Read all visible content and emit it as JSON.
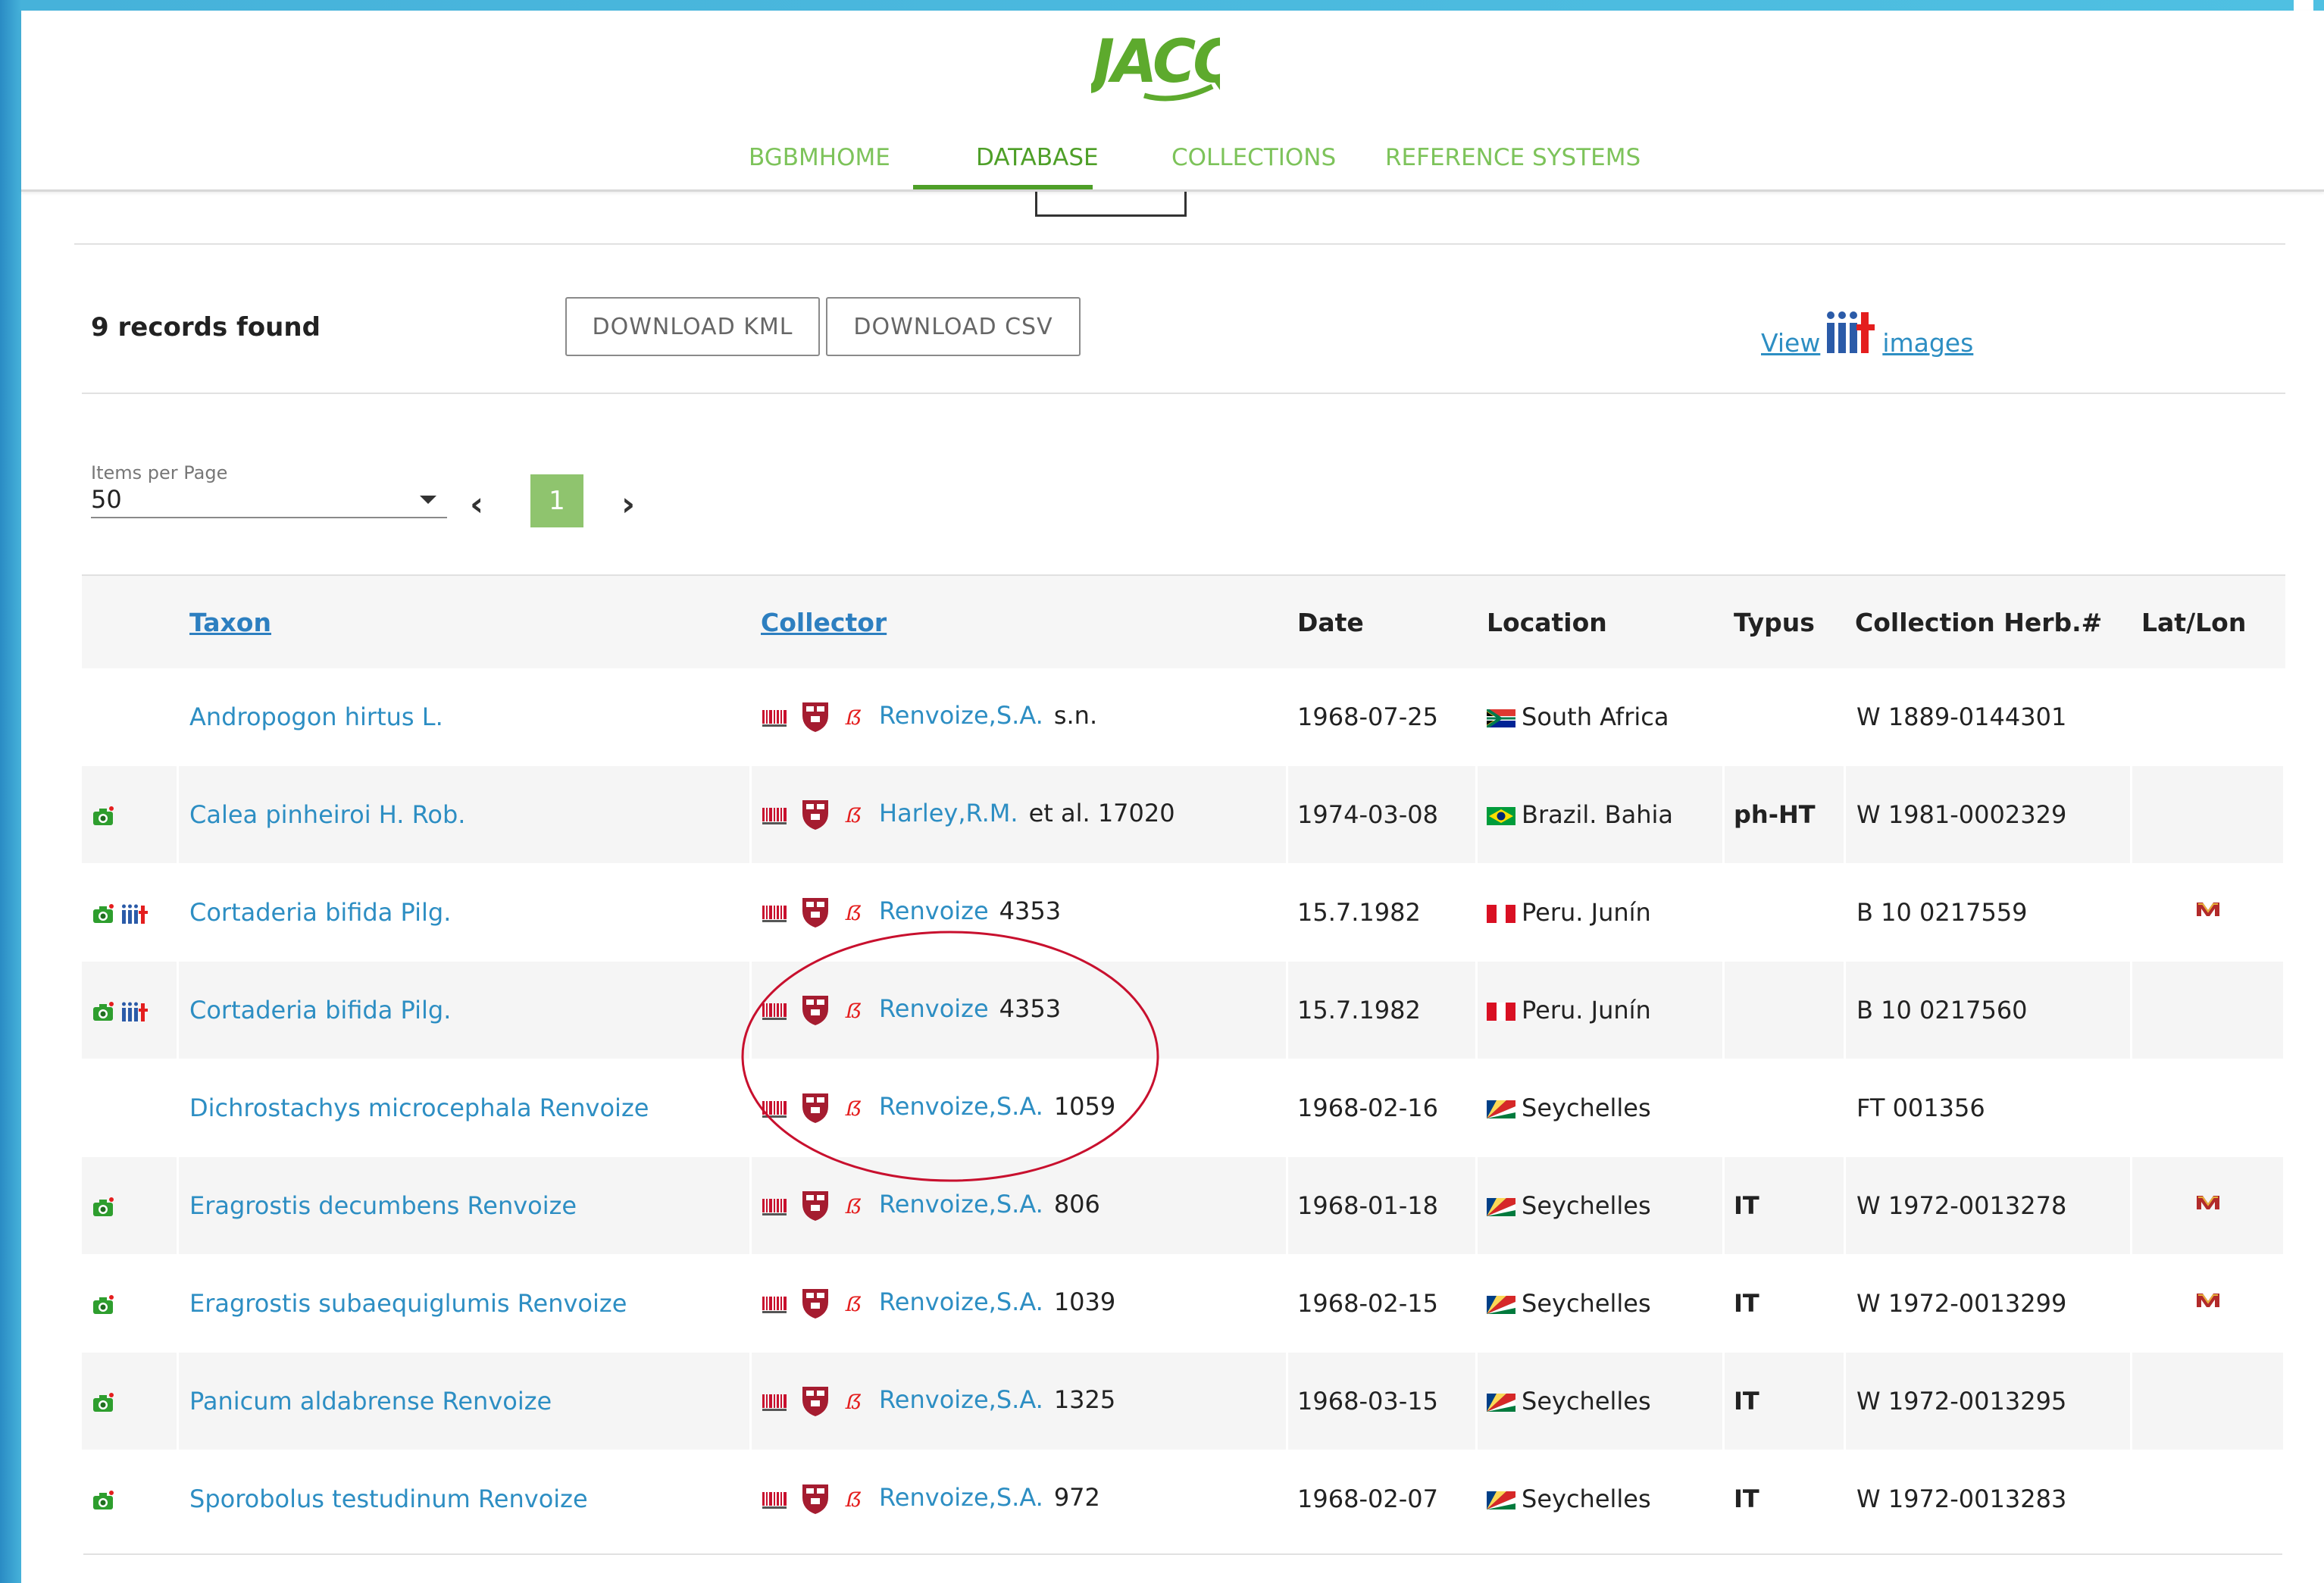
{
  "header": {
    "logo_text": "JACQ",
    "nav": [
      {
        "label": "BGBMHOME",
        "active": false
      },
      {
        "label": "DATABASE",
        "active": true
      },
      {
        "label": "COLLECTIONS",
        "active": false
      },
      {
        "label": "REFERENCE SYSTEMS",
        "active": false
      }
    ]
  },
  "results": {
    "count_text": "9 records found",
    "download_kml": "DOWNLOAD KML",
    "download_csv": "DOWNLOAD CSV",
    "iiif_prefix": "View",
    "iiif_logo_text": "iiif",
    "iiif_suffix": "images"
  },
  "pager": {
    "items_per_page_label": "Items per Page",
    "items_per_page_value": "50",
    "prev": "‹",
    "current_page": "1",
    "next": "›"
  },
  "table": {
    "columns": [
      "Taxon",
      "Collector",
      "Date",
      "Location",
      "Typus",
      "Collection Herb.#",
      "Lat/Lon"
    ],
    "rows": [
      {
        "taxon": "Andropogon hirtus L.",
        "collector": "Renvoize,S.A.",
        "number": "s.n.",
        "date": "1968-07-25",
        "location": "South Africa",
        "flag": "za",
        "typus": "",
        "herb": "W 1889-0144301",
        "camera": false,
        "iiif": false,
        "map": false
      },
      {
        "taxon": "Calea pinheiroi H. Rob.",
        "collector": "Harley,R.M.",
        "number": "et al. 17020",
        "date": "1974-03-08",
        "location": "Brazil. Bahia",
        "flag": "br",
        "typus": "ph-HT",
        "herb": "W 1981-0002329",
        "camera": true,
        "iiif": false,
        "map": false
      },
      {
        "taxon": "Cortaderia bifida Pilg.",
        "collector": "Renvoize",
        "number": "4353",
        "date": "15.7.1982",
        "location": "Peru. Junín",
        "flag": "pe",
        "typus": "",
        "herb": "B 10 0217559",
        "camera": true,
        "iiif": true,
        "map": true
      },
      {
        "taxon": "Cortaderia bifida Pilg.",
        "collector": "Renvoize",
        "number": "4353",
        "date": "15.7.1982",
        "location": "Peru. Junín",
        "flag": "pe",
        "typus": "",
        "herb": "B 10 0217560",
        "camera": true,
        "iiif": true,
        "map": false
      },
      {
        "taxon": "Dichrostachys microcephala Renvoize",
        "collector": "Renvoize,S.A.",
        "number": "1059",
        "date": "1968-02-16",
        "location": "Seychelles",
        "flag": "sc",
        "typus": "",
        "herb": "FT 001356",
        "camera": false,
        "iiif": false,
        "map": false
      },
      {
        "taxon": "Eragrostis decumbens Renvoize",
        "collector": "Renvoize,S.A.",
        "number": "806",
        "date": "1968-01-18",
        "location": "Seychelles",
        "flag": "sc",
        "typus": "IT",
        "herb": "W 1972-0013278",
        "camera": true,
        "iiif": false,
        "map": true
      },
      {
        "taxon": "Eragrostis subaequiglumis Renvoize",
        "collector": "Renvoize,S.A.",
        "number": "1039",
        "date": "1968-02-15",
        "location": "Seychelles",
        "flag": "sc",
        "typus": "IT",
        "herb": "W 1972-0013299",
        "camera": true,
        "iiif": false,
        "map": true
      },
      {
        "taxon": "Panicum aldabrense Renvoize",
        "collector": "Renvoize,S.A.",
        "number": "1325",
        "date": "1968-03-15",
        "location": "Seychelles",
        "flag": "sc",
        "typus": "IT",
        "herb": "W 1972-0013295",
        "camera": true,
        "iiif": false,
        "map": false
      },
      {
        "taxon": "Sporobolus testudinum Renvoize",
        "collector": "Renvoize,S.A.",
        "number": "972",
        "date": "1968-02-07",
        "location": "Seychelles",
        "flag": "sc",
        "typus": "IT",
        "herb": "W 1972-0013283",
        "camera": true,
        "iiif": false,
        "map": false
      }
    ]
  },
  "colors": {
    "brand_green": "#5daa2d",
    "nav_green": "#7dc35a",
    "link_blue": "#2d8ec3",
    "typus_red": "#e41e1e",
    "annotation_red": "#c8102e"
  }
}
